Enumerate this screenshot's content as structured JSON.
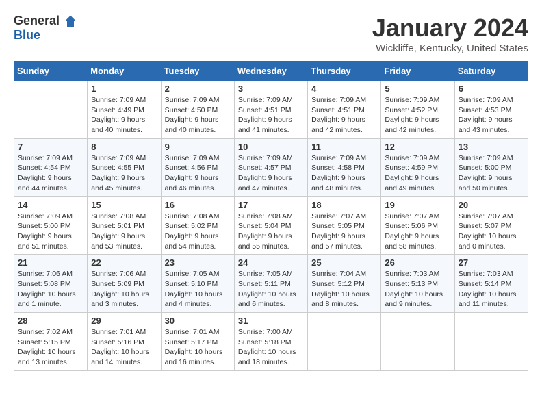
{
  "logo": {
    "general": "General",
    "blue": "Blue"
  },
  "title": "January 2024",
  "location": "Wickliffe, Kentucky, United States",
  "weekdays": [
    "Sunday",
    "Monday",
    "Tuesday",
    "Wednesday",
    "Thursday",
    "Friday",
    "Saturday"
  ],
  "weeks": [
    [
      {
        "day": "",
        "sunrise": "",
        "sunset": "",
        "daylight": ""
      },
      {
        "day": "1",
        "sunrise": "Sunrise: 7:09 AM",
        "sunset": "Sunset: 4:49 PM",
        "daylight": "Daylight: 9 hours and 40 minutes."
      },
      {
        "day": "2",
        "sunrise": "Sunrise: 7:09 AM",
        "sunset": "Sunset: 4:50 PM",
        "daylight": "Daylight: 9 hours and 40 minutes."
      },
      {
        "day": "3",
        "sunrise": "Sunrise: 7:09 AM",
        "sunset": "Sunset: 4:51 PM",
        "daylight": "Daylight: 9 hours and 41 minutes."
      },
      {
        "day": "4",
        "sunrise": "Sunrise: 7:09 AM",
        "sunset": "Sunset: 4:51 PM",
        "daylight": "Daylight: 9 hours and 42 minutes."
      },
      {
        "day": "5",
        "sunrise": "Sunrise: 7:09 AM",
        "sunset": "Sunset: 4:52 PM",
        "daylight": "Daylight: 9 hours and 42 minutes."
      },
      {
        "day": "6",
        "sunrise": "Sunrise: 7:09 AM",
        "sunset": "Sunset: 4:53 PM",
        "daylight": "Daylight: 9 hours and 43 minutes."
      }
    ],
    [
      {
        "day": "7",
        "sunrise": "Sunrise: 7:09 AM",
        "sunset": "Sunset: 4:54 PM",
        "daylight": "Daylight: 9 hours and 44 minutes."
      },
      {
        "day": "8",
        "sunrise": "Sunrise: 7:09 AM",
        "sunset": "Sunset: 4:55 PM",
        "daylight": "Daylight: 9 hours and 45 minutes."
      },
      {
        "day": "9",
        "sunrise": "Sunrise: 7:09 AM",
        "sunset": "Sunset: 4:56 PM",
        "daylight": "Daylight: 9 hours and 46 minutes."
      },
      {
        "day": "10",
        "sunrise": "Sunrise: 7:09 AM",
        "sunset": "Sunset: 4:57 PM",
        "daylight": "Daylight: 9 hours and 47 minutes."
      },
      {
        "day": "11",
        "sunrise": "Sunrise: 7:09 AM",
        "sunset": "Sunset: 4:58 PM",
        "daylight": "Daylight: 9 hours and 48 minutes."
      },
      {
        "day": "12",
        "sunrise": "Sunrise: 7:09 AM",
        "sunset": "Sunset: 4:59 PM",
        "daylight": "Daylight: 9 hours and 49 minutes."
      },
      {
        "day": "13",
        "sunrise": "Sunrise: 7:09 AM",
        "sunset": "Sunset: 5:00 PM",
        "daylight": "Daylight: 9 hours and 50 minutes."
      }
    ],
    [
      {
        "day": "14",
        "sunrise": "Sunrise: 7:09 AM",
        "sunset": "Sunset: 5:00 PM",
        "daylight": "Daylight: 9 hours and 51 minutes."
      },
      {
        "day": "15",
        "sunrise": "Sunrise: 7:08 AM",
        "sunset": "Sunset: 5:01 PM",
        "daylight": "Daylight: 9 hours and 53 minutes."
      },
      {
        "day": "16",
        "sunrise": "Sunrise: 7:08 AM",
        "sunset": "Sunset: 5:02 PM",
        "daylight": "Daylight: 9 hours and 54 minutes."
      },
      {
        "day": "17",
        "sunrise": "Sunrise: 7:08 AM",
        "sunset": "Sunset: 5:04 PM",
        "daylight": "Daylight: 9 hours and 55 minutes."
      },
      {
        "day": "18",
        "sunrise": "Sunrise: 7:07 AM",
        "sunset": "Sunset: 5:05 PM",
        "daylight": "Daylight: 9 hours and 57 minutes."
      },
      {
        "day": "19",
        "sunrise": "Sunrise: 7:07 AM",
        "sunset": "Sunset: 5:06 PM",
        "daylight": "Daylight: 9 hours and 58 minutes."
      },
      {
        "day": "20",
        "sunrise": "Sunrise: 7:07 AM",
        "sunset": "Sunset: 5:07 PM",
        "daylight": "Daylight: 10 hours and 0 minutes."
      }
    ],
    [
      {
        "day": "21",
        "sunrise": "Sunrise: 7:06 AM",
        "sunset": "Sunset: 5:08 PM",
        "daylight": "Daylight: 10 hours and 1 minute."
      },
      {
        "day": "22",
        "sunrise": "Sunrise: 7:06 AM",
        "sunset": "Sunset: 5:09 PM",
        "daylight": "Daylight: 10 hours and 3 minutes."
      },
      {
        "day": "23",
        "sunrise": "Sunrise: 7:05 AM",
        "sunset": "Sunset: 5:10 PM",
        "daylight": "Daylight: 10 hours and 4 minutes."
      },
      {
        "day": "24",
        "sunrise": "Sunrise: 7:05 AM",
        "sunset": "Sunset: 5:11 PM",
        "daylight": "Daylight: 10 hours and 6 minutes."
      },
      {
        "day": "25",
        "sunrise": "Sunrise: 7:04 AM",
        "sunset": "Sunset: 5:12 PM",
        "daylight": "Daylight: 10 hours and 8 minutes."
      },
      {
        "day": "26",
        "sunrise": "Sunrise: 7:03 AM",
        "sunset": "Sunset: 5:13 PM",
        "daylight": "Daylight: 10 hours and 9 minutes."
      },
      {
        "day": "27",
        "sunrise": "Sunrise: 7:03 AM",
        "sunset": "Sunset: 5:14 PM",
        "daylight": "Daylight: 10 hours and 11 minutes."
      }
    ],
    [
      {
        "day": "28",
        "sunrise": "Sunrise: 7:02 AM",
        "sunset": "Sunset: 5:15 PM",
        "daylight": "Daylight: 10 hours and 13 minutes."
      },
      {
        "day": "29",
        "sunrise": "Sunrise: 7:01 AM",
        "sunset": "Sunset: 5:16 PM",
        "daylight": "Daylight: 10 hours and 14 minutes."
      },
      {
        "day": "30",
        "sunrise": "Sunrise: 7:01 AM",
        "sunset": "Sunset: 5:17 PM",
        "daylight": "Daylight: 10 hours and 16 minutes."
      },
      {
        "day": "31",
        "sunrise": "Sunrise: 7:00 AM",
        "sunset": "Sunset: 5:18 PM",
        "daylight": "Daylight: 10 hours and 18 minutes."
      },
      {
        "day": "",
        "sunrise": "",
        "sunset": "",
        "daylight": ""
      },
      {
        "day": "",
        "sunrise": "",
        "sunset": "",
        "daylight": ""
      },
      {
        "day": "",
        "sunrise": "",
        "sunset": "",
        "daylight": ""
      }
    ]
  ]
}
